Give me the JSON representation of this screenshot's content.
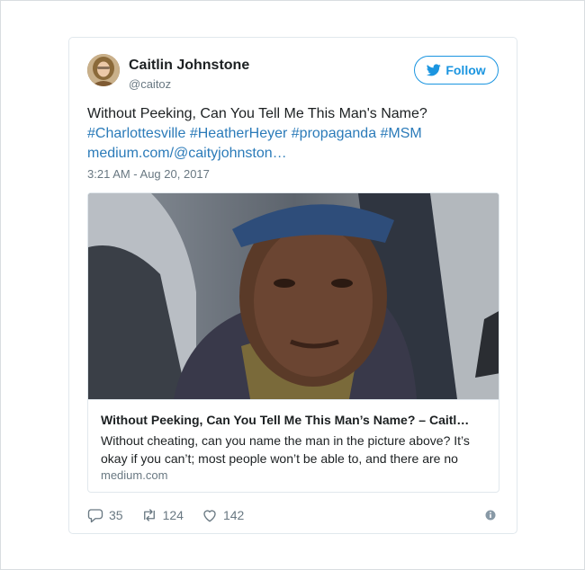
{
  "author": {
    "name": "Caitlin Johnstone",
    "handle": "@caitoz"
  },
  "follow_label": "Follow",
  "tweet": {
    "text_plain": "Without Peeking, Can You Tell Me This Man's Name?",
    "hashtags": "#Charlottesville #HeatherHeyer #propaganda #MSM",
    "url": "medium.com/@caityjohnston…",
    "timestamp": "3:21 AM - Aug 20, 2017"
  },
  "card": {
    "title": "Without Peeking, Can You Tell Me This Man’s Name? – Caitl…",
    "description": "Without cheating, can you name the man in the picture above? It’s okay if you can’t; most people won’t be able to, and there are no",
    "domain": "medium.com"
  },
  "actions": {
    "replies": "35",
    "retweets": "124",
    "likes": "142"
  },
  "icons": [
    "twitter-bird-icon",
    "reply-icon",
    "retweet-icon",
    "heart-icon",
    "info-icon"
  ],
  "colors": {
    "link": "#2b7bb9",
    "follow": "#1b95e0",
    "muted": "#697882",
    "border": "#e1e8ed"
  }
}
